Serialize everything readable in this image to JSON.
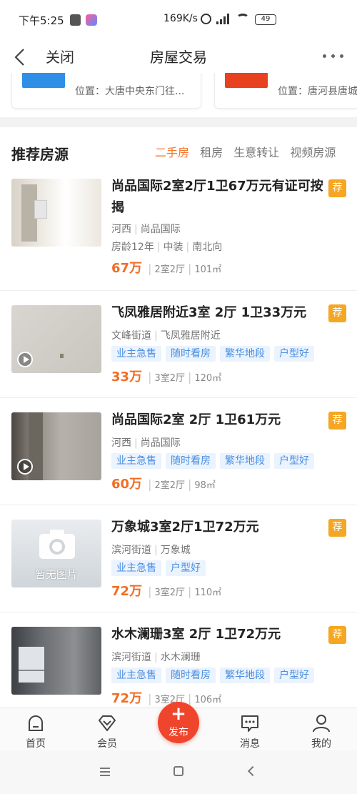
{
  "status": {
    "time": "下午5:25",
    "speed": "169K/s",
    "battery": "49"
  },
  "nav": {
    "close_label": "关闭",
    "title": "房屋交易"
  },
  "partial_cards": [
    {
      "location": "位置：大唐中央东门往...",
      "thumb_color": "#2f8ee6"
    },
    {
      "location": "位置：唐河县唐城",
      "thumb_color": "#e8411f"
    }
  ],
  "recommend": {
    "title": "推荐房源",
    "tabs": [
      "二手房",
      "租房",
      "生意转让",
      "视频房源"
    ],
    "active_tab": "二手房"
  },
  "listings": [
    {
      "title": "尚品国际2室2厅1卫67万元有证可按揭",
      "badge": "荐",
      "meta1": [
        "河西",
        "尚品国际"
      ],
      "meta2": [
        "房龄12年",
        "中装",
        "南北向"
      ],
      "tags": [],
      "price": "67万",
      "layout": "2室2厅",
      "area": "101㎡",
      "has_video": false,
      "thumb": "room-bright"
    },
    {
      "title": "飞凤雅居附近3室 2厅 1卫33万元",
      "badge": "荐",
      "meta1": [
        "文峰街道",
        "飞凤雅居附近"
      ],
      "meta2": [],
      "tags": [
        "业主急售",
        "随时看房",
        "繁华地段",
        "户型好"
      ],
      "price": "33万",
      "layout": "3室2厅",
      "area": "120㎡",
      "has_video": true,
      "thumb": "wall-plain"
    },
    {
      "title": "尚品国际2室 2厅 1卫61万元",
      "badge": "荐",
      "meta1": [
        "河西",
        "尚品国际"
      ],
      "meta2": [],
      "tags": [
        "业主急售",
        "随时看房",
        "繁华地段",
        "户型好"
      ],
      "price": "60万",
      "layout": "2室2厅",
      "area": "98㎡",
      "has_video": true,
      "thumb": "concrete"
    },
    {
      "title": "万象城3室2厅1卫72万元",
      "badge": "荐",
      "meta1": [
        "滨河街道",
        "万象城"
      ],
      "meta2": [],
      "tags": [
        "业主急售",
        "户型好"
      ],
      "price": "72万",
      "layout": "3室2厅",
      "area": "110㎡",
      "has_video": false,
      "thumb": "placeholder",
      "thumb_text": "暂无图片"
    },
    {
      "title": "水木澜珊3室 2厅 1卫72万元",
      "badge": "荐",
      "meta1": [
        "滨河街道",
        "水木澜珊"
      ],
      "meta2": [],
      "tags": [
        "业主急售",
        "随时看房",
        "繁华地段",
        "户型好"
      ],
      "price": "72万",
      "layout": "3室2厅",
      "area": "106㎡",
      "has_video": false,
      "thumb": "window-room"
    }
  ],
  "tabbar": {
    "items": [
      {
        "label": "首页",
        "icon": "home-icon"
      },
      {
        "label": "会员",
        "icon": "diamond-icon"
      },
      {
        "label": "发布",
        "icon": "plus-icon"
      },
      {
        "label": "消息",
        "icon": "message-icon"
      },
      {
        "label": "我的",
        "icon": "user-icon"
      }
    ]
  },
  "colors": {
    "accent": "#f4772d",
    "price": "#f16d24",
    "badge": "#f5a623",
    "tag_bg": "#eaf3fe",
    "tag_text": "#4a8ee0",
    "publish": "#f0452d"
  }
}
